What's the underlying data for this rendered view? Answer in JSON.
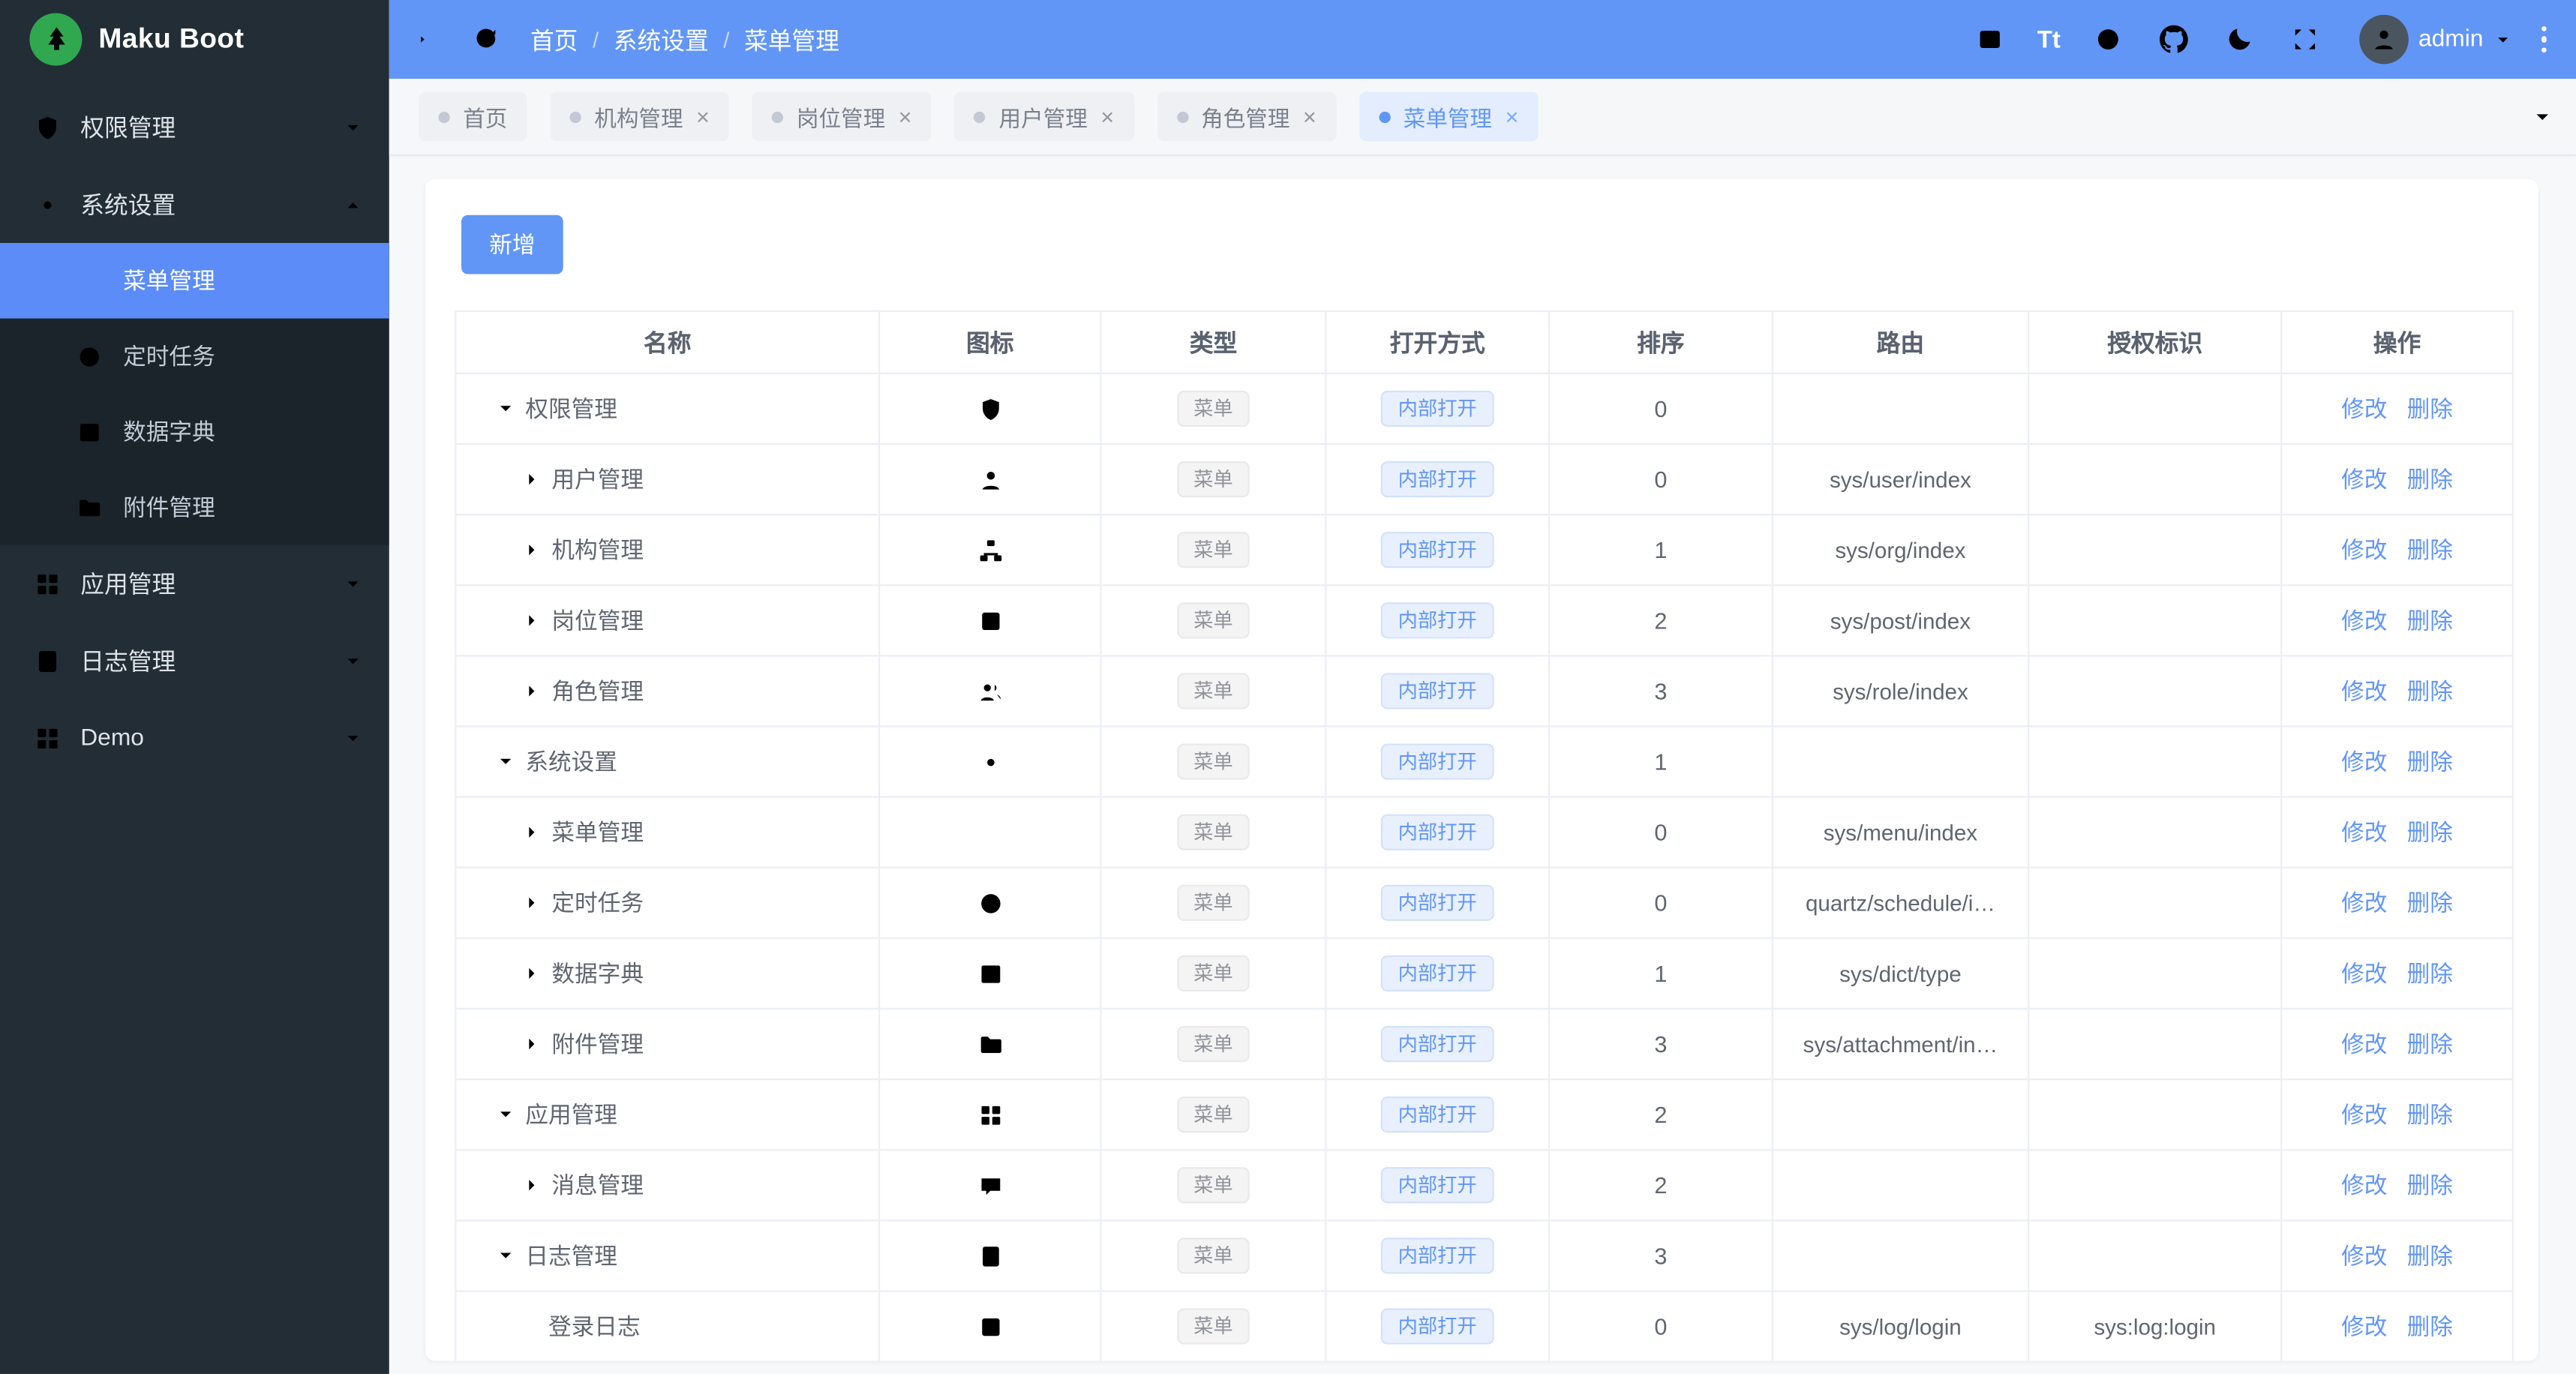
{
  "colors": {
    "accent": "#6196f7",
    "sidebar_bg": "#222d35",
    "active_item_bg": "#5b8cf7",
    "logo_green": "#2fa84f",
    "tag_info_text": "#909399",
    "tag_open_text": "#6196f7"
  },
  "sidebar": {
    "logo_text": "Maku Boot",
    "items": [
      {
        "label": "权限管理",
        "icon": "shield",
        "state": "collapsed"
      },
      {
        "label": "系统设置",
        "icon": "gear",
        "state": "expanded",
        "children": [
          {
            "label": "菜单管理",
            "icon": "menu",
            "active": true
          },
          {
            "label": "定时任务",
            "icon": "clock",
            "active": false
          },
          {
            "label": "数据字典",
            "icon": "dict",
            "active": false
          },
          {
            "label": "附件管理",
            "icon": "folder",
            "active": false
          }
        ]
      },
      {
        "label": "应用管理",
        "icon": "apps",
        "state": "collapsed"
      },
      {
        "label": "日志管理",
        "icon": "log",
        "state": "collapsed"
      },
      {
        "label": "Demo",
        "icon": "apps",
        "state": "collapsed"
      }
    ]
  },
  "topbar": {
    "breadcrumb": [
      "首页",
      "系统设置",
      "菜单管理"
    ],
    "separator": "/",
    "font_toggle": "Tt",
    "username": "admin"
  },
  "tabbar": {
    "close_glyph": "×",
    "tabs": [
      {
        "label": "首页",
        "closable": false,
        "active": false
      },
      {
        "label": "机构管理",
        "closable": true,
        "active": false
      },
      {
        "label": "岗位管理",
        "closable": true,
        "active": false
      },
      {
        "label": "用户管理",
        "closable": true,
        "active": false
      },
      {
        "label": "角色管理",
        "closable": true,
        "active": false
      },
      {
        "label": "菜单管理",
        "closable": true,
        "active": true
      }
    ]
  },
  "toolbar": {
    "add_label": "新增"
  },
  "table": {
    "columns": [
      "名称",
      "图标",
      "类型",
      "打开方式",
      "排序",
      "路由",
      "授权标识",
      "操作"
    ],
    "actions": [
      "修改",
      "删除"
    ],
    "rows": [
      {
        "name": "权限管理",
        "icon": "shield",
        "arrow": "down",
        "indent": 0,
        "type": "菜单",
        "open": "内部打开",
        "sort": "0",
        "route": "",
        "perm": ""
      },
      {
        "name": "用户管理",
        "icon": "user",
        "arrow": "right",
        "indent": 1,
        "type": "菜单",
        "open": "内部打开",
        "sort": "0",
        "route": "sys/user/index",
        "perm": ""
      },
      {
        "name": "机构管理",
        "icon": "org",
        "arrow": "right",
        "indent": 1,
        "type": "菜单",
        "open": "内部打开",
        "sort": "1",
        "route": "sys/org/index",
        "perm": ""
      },
      {
        "name": "岗位管理",
        "icon": "post",
        "arrow": "right",
        "indent": 1,
        "type": "菜单",
        "open": "内部打开",
        "sort": "2",
        "route": "sys/post/index",
        "perm": ""
      },
      {
        "name": "角色管理",
        "icon": "role",
        "arrow": "right",
        "indent": 1,
        "type": "菜单",
        "open": "内部打开",
        "sort": "3",
        "route": "sys/role/index",
        "perm": ""
      },
      {
        "name": "系统设置",
        "icon": "gear",
        "arrow": "down",
        "indent": 0,
        "type": "菜单",
        "open": "内部打开",
        "sort": "1",
        "route": "",
        "perm": ""
      },
      {
        "name": "菜单管理",
        "icon": "menu",
        "arrow": "right",
        "indent": 1,
        "type": "菜单",
        "open": "内部打开",
        "sort": "0",
        "route": "sys/menu/index",
        "perm": ""
      },
      {
        "name": "定时任务",
        "icon": "clock",
        "arrow": "right",
        "indent": 1,
        "type": "菜单",
        "open": "内部打开",
        "sort": "0",
        "route": "quartz/schedule/i…",
        "perm": ""
      },
      {
        "name": "数据字典",
        "icon": "dict",
        "arrow": "right",
        "indent": 1,
        "type": "菜单",
        "open": "内部打开",
        "sort": "1",
        "route": "sys/dict/type",
        "perm": ""
      },
      {
        "name": "附件管理",
        "icon": "folder",
        "arrow": "right",
        "indent": 1,
        "type": "菜单",
        "open": "内部打开",
        "sort": "3",
        "route": "sys/attachment/in…",
        "perm": ""
      },
      {
        "name": "应用管理",
        "icon": "apps",
        "arrow": "down",
        "indent": 0,
        "type": "菜单",
        "open": "内部打开",
        "sort": "2",
        "route": "",
        "perm": ""
      },
      {
        "name": "消息管理",
        "icon": "message",
        "arrow": "right",
        "indent": 1,
        "type": "菜单",
        "open": "内部打开",
        "sort": "2",
        "route": "",
        "perm": ""
      },
      {
        "name": "日志管理",
        "icon": "log",
        "arrow": "down",
        "indent": 0,
        "type": "菜单",
        "open": "内部打开",
        "sort": "3",
        "route": "",
        "perm": ""
      },
      {
        "name": "登录日志",
        "icon": "post",
        "arrow": "none",
        "indent": 2,
        "type": "菜单",
        "open": "内部打开",
        "sort": "0",
        "route": "sys/log/login",
        "perm": "sys:log:login"
      }
    ]
  }
}
